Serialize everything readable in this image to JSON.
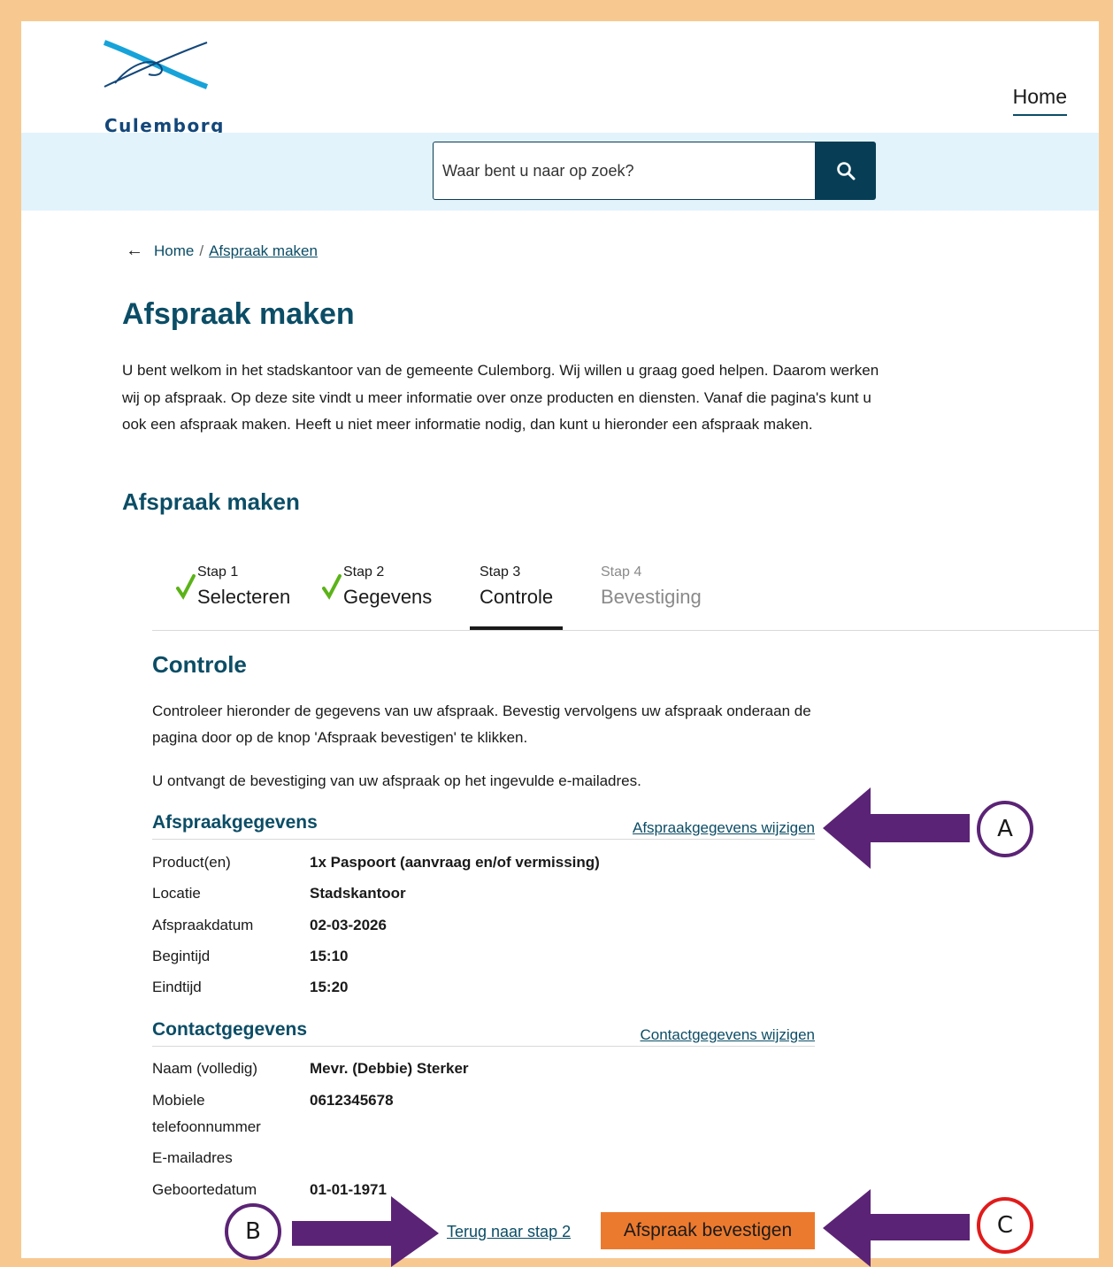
{
  "header": {
    "logo_text": "Culemborg",
    "nav_home": "Home"
  },
  "search": {
    "placeholder": "Waar bent u naar op zoek?"
  },
  "breadcrumb": {
    "back_arrow": "←",
    "home": "Home",
    "separator": "/",
    "current": "Afspraak maken"
  },
  "main": {
    "title": "Afspraak maken",
    "intro": "U bent welkom in het stadskantoor van de gemeente Culemborg. Wij willen u graag goed helpen. Daarom werken wij op afspraak. Op deze site vindt u meer informatie over onze producten en diensten. Vanaf die pagina's kunt u ook een afspraak maken. Heeft u niet meer informatie nodig, dan kunt u hieronder een afspraak maken.",
    "subtitle": "Afspraak maken"
  },
  "steps": [
    {
      "small": "Stap 1",
      "big": "Selecteren",
      "status": "done"
    },
    {
      "small": "Stap 2",
      "big": "Gegevens",
      "status": "done"
    },
    {
      "small": "Stap 3",
      "big": "Controle",
      "status": "active"
    },
    {
      "small": "Stap 4",
      "big": "Bevestiging",
      "status": "future"
    }
  ],
  "controle": {
    "title": "Controle",
    "para1": "Controleer hieronder de gegevens van uw afspraak. Bevestig vervolgens uw afspraak onderaan de pagina door op de knop 'Afspraak bevestigen' te klikken.",
    "para2": "U ontvangt de bevestiging van uw afspraak op het ingevulde e-mailadres."
  },
  "afspraak": {
    "title": "Afspraakgegevens",
    "edit_link": "Afspraakgegevens wijzigen",
    "rows": [
      {
        "label": "Product(en)",
        "value": "1x Paspoort (aanvraag en/of vermissing)"
      },
      {
        "label": "Locatie",
        "value": "Stadskantoor"
      },
      {
        "label": "Afspraakdatum",
        "value": "02-03-2026"
      },
      {
        "label": "Begintijd",
        "value": "15:10"
      },
      {
        "label": "Eindtijd",
        "value": "15:20"
      }
    ]
  },
  "contact": {
    "title": "Contactgegevens",
    "edit_link": "Contactgegevens wijzigen",
    "rows": [
      {
        "label": "Naam (volledig)",
        "value": "Mevr. (Debbie) Sterker"
      },
      {
        "label": "Mobiele telefoonnummer",
        "value": "0612345678"
      },
      {
        "label": "E-mailadres",
        "value": ""
      },
      {
        "label": "Geboortedatum",
        "value": "01-01-1971"
      }
    ]
  },
  "actions": {
    "back": "Terug naar stap 2",
    "confirm": "Afspraak bevestigen"
  },
  "annotations": {
    "a": "A",
    "b": "B",
    "c": "C",
    "arrow_color": "#5b2375",
    "marker_c_color": "#e01b1b"
  },
  "colors": {
    "frame": "#f7c991",
    "brand": "#0b4d66",
    "search_button": "#073e55",
    "search_band": "#e2f3fb",
    "confirm_button": "#ec7a2e",
    "check": "#5bb318"
  }
}
